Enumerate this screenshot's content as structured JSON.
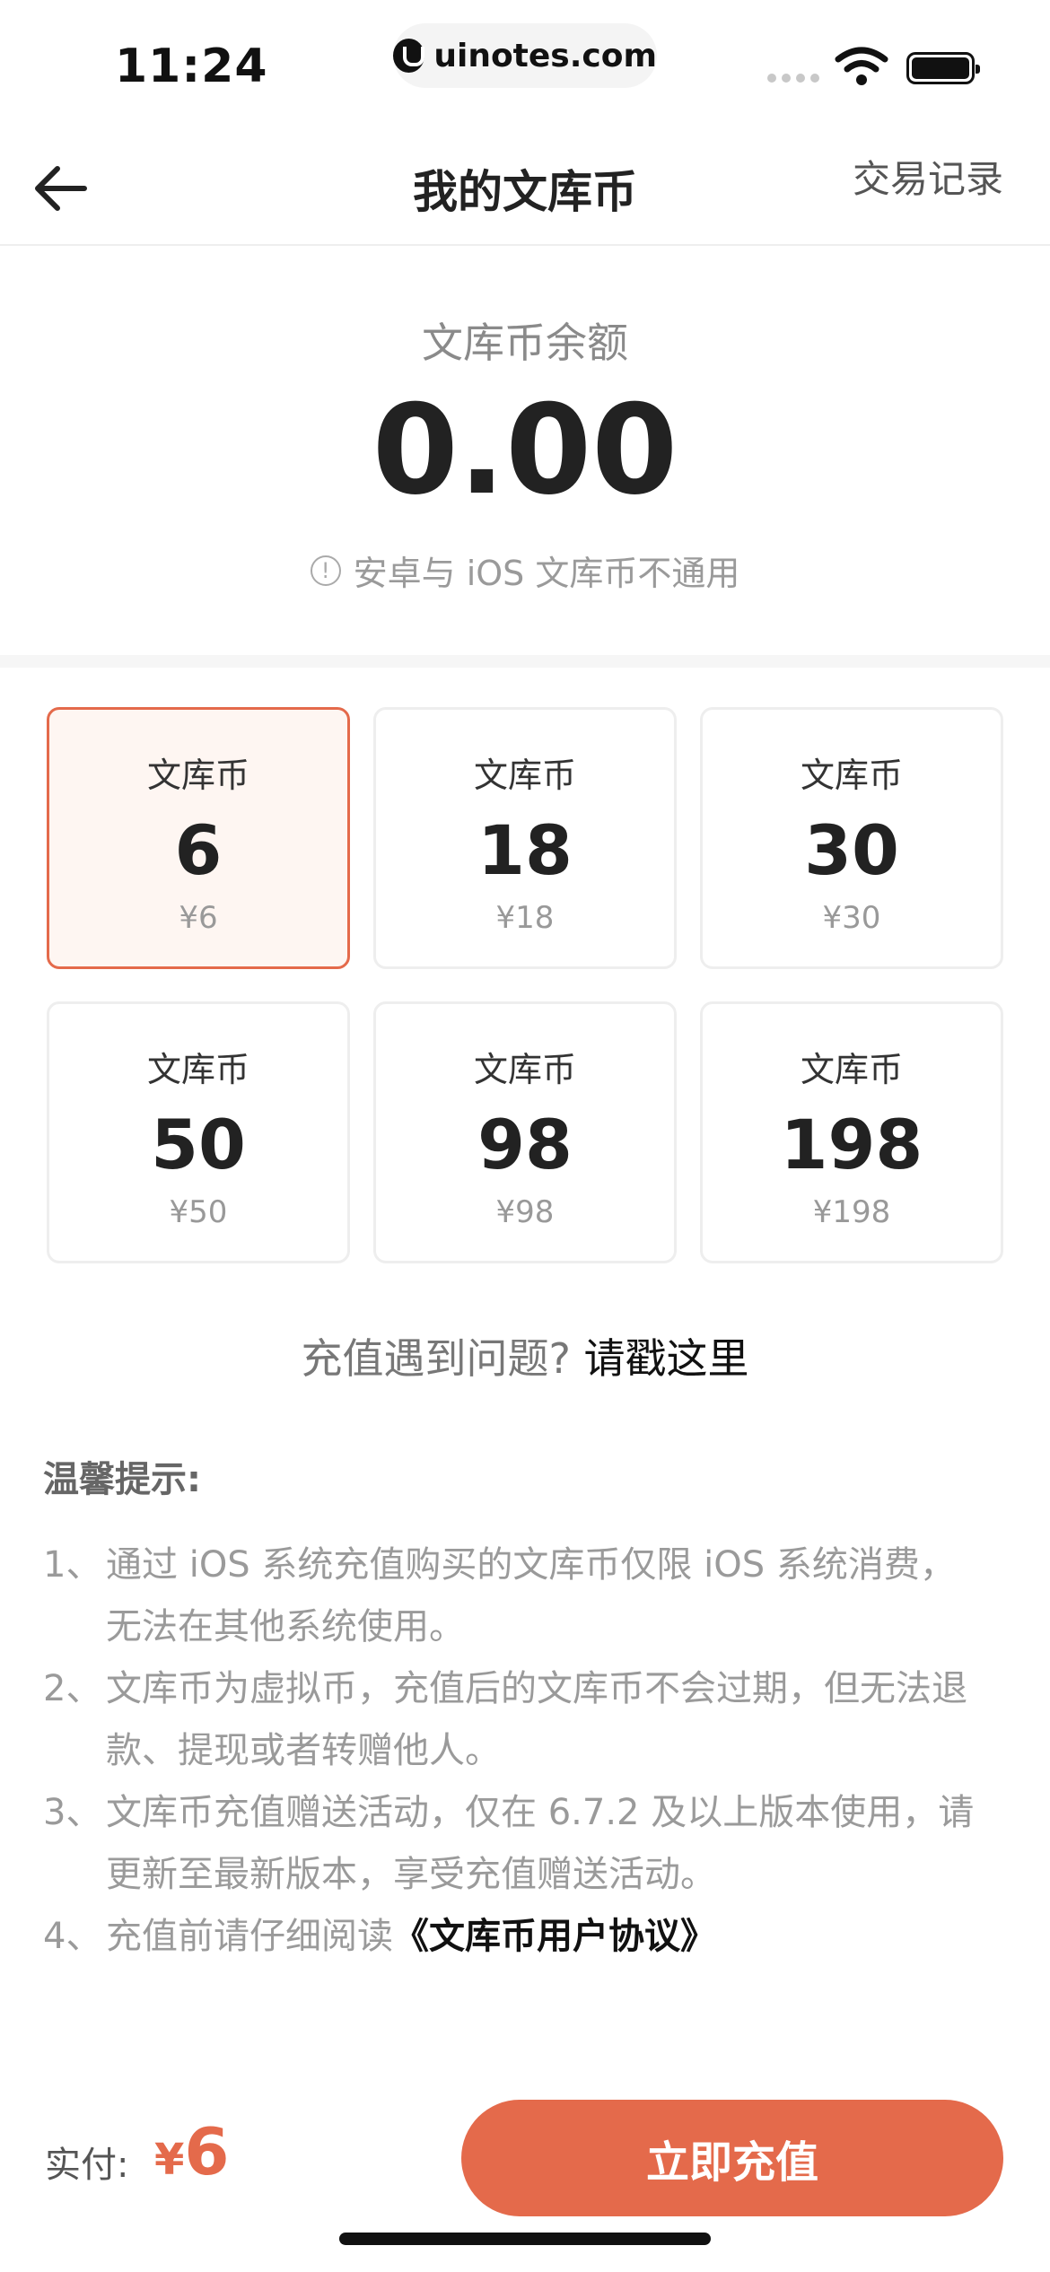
{
  "status_bar": {
    "time": "11:24",
    "url": "uinotes.com"
  },
  "nav": {
    "title": "我的文库币",
    "right_link": "交易记录"
  },
  "balance": {
    "label": "文库币余额",
    "value": "0.00",
    "note": "安卓与 iOS 文库币不通用"
  },
  "options": [
    {
      "label": "文库币",
      "amount": "6",
      "price": "¥6",
      "selected": true
    },
    {
      "label": "文库币",
      "amount": "18",
      "price": "¥18",
      "selected": false
    },
    {
      "label": "文库币",
      "amount": "30",
      "price": "¥30",
      "selected": false
    },
    {
      "label": "文库币",
      "amount": "50",
      "price": "¥50",
      "selected": false
    },
    {
      "label": "文库币",
      "amount": "98",
      "price": "¥98",
      "selected": false
    },
    {
      "label": "文库币",
      "amount": "198",
      "price": "¥198",
      "selected": false
    }
  ],
  "help": {
    "text": "充值遇到问题? ",
    "link": "请戳这里"
  },
  "tips": {
    "title": "温馨提示:",
    "items": [
      {
        "num": "1、",
        "text": "通过 iOS 系统充值购买的文库币仅限 iOS 系统消费，无法在其他系统使用。"
      },
      {
        "num": "2、",
        "text": "文库币为虚拟币，充值后的文库币不会过期，但无法退款、提现或者转赠他人。"
      },
      {
        "num": "3、",
        "text": "文库币充值赠送活动，仅在 6.7.2 及以上版本使用，请更新至最新版本，享受充值赠送活动。"
      },
      {
        "num": "4、",
        "text": "充值前请仔细阅读",
        "link": "《文库币用户协议》"
      }
    ]
  },
  "footer": {
    "pay_label": "实付:",
    "pay_currency": "¥",
    "pay_amount": "6",
    "button": "立即充值"
  },
  "colors": {
    "accent": "#e46a4b",
    "selected_bg": "#fef6f2"
  }
}
